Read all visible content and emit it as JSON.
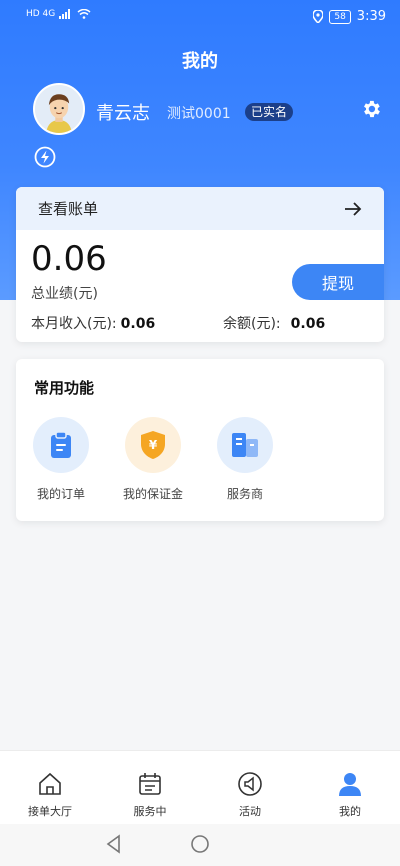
{
  "statusbar": {
    "network": "HD 4G",
    "battery": "58",
    "time": "3:39"
  },
  "page_title": "我的",
  "profile": {
    "name": "青云志",
    "user_id": "测试0001",
    "verified_badge": "已实名"
  },
  "wallet": {
    "bill_link": "查看账单",
    "total_performance": "0.06",
    "total_performance_label": "总业绩(元)",
    "withdraw_button": "提现",
    "month_income_label": "本月收入(元):",
    "month_income_value": "0.06",
    "balance_label": "余额(元):",
    "balance_value": "0.06"
  },
  "functions": {
    "title": "常用功能",
    "items": [
      {
        "label": "我的订单",
        "icon": "clipboard-icon"
      },
      {
        "label": "我的保证金",
        "icon": "yen-shield-icon"
      },
      {
        "label": "服务商",
        "icon": "building-icon"
      }
    ]
  },
  "tabbar": {
    "items": [
      {
        "label": "接单大厅",
        "icon": "home-icon"
      },
      {
        "label": "服务中",
        "icon": "calendar-icon"
      },
      {
        "label": "活动",
        "icon": "megaphone-icon"
      },
      {
        "label": "我的",
        "icon": "person-icon"
      }
    ],
    "active_color": "#3d86f5"
  },
  "colors": {
    "brand": "#2f7bff",
    "accent": "#3d86f5"
  }
}
